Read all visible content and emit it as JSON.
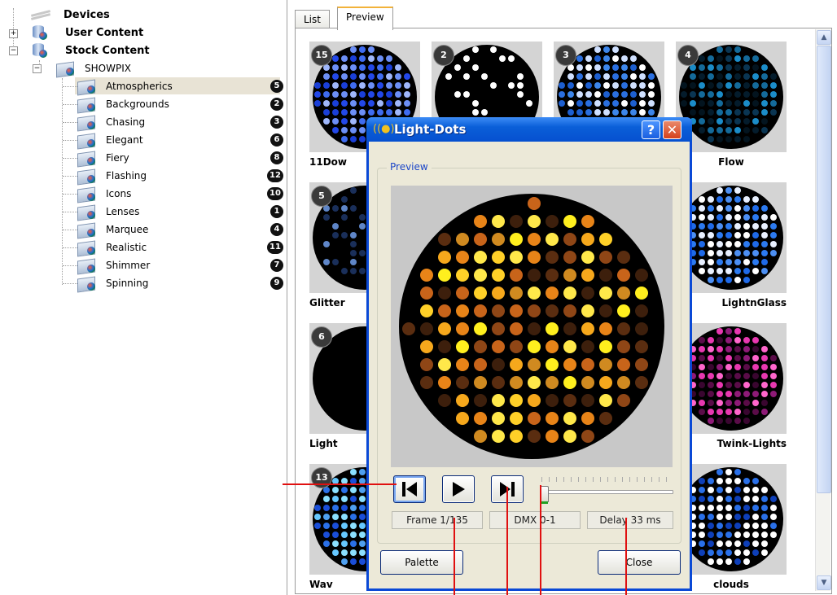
{
  "tree": {
    "devices": "Devices",
    "user_content": "User Content",
    "stock_content": "Stock Content",
    "showpix": "SHOWPIX",
    "items": [
      {
        "label": "Atmospherics",
        "count": "5"
      },
      {
        "label": "Backgrounds",
        "count": "2"
      },
      {
        "label": "Chasing",
        "count": "3"
      },
      {
        "label": "Elegant",
        "count": "6"
      },
      {
        "label": "Fiery",
        "count": "8"
      },
      {
        "label": "Flashing",
        "count": "12"
      },
      {
        "label": "Icons",
        "count": "10"
      },
      {
        "label": "Lenses",
        "count": "1"
      },
      {
        "label": "Marquee",
        "count": "4"
      },
      {
        "label": "Realistic",
        "count": "11"
      },
      {
        "label": "Shimmer",
        "count": "7"
      },
      {
        "label": "Spinning",
        "count": "9"
      }
    ],
    "selected": "Atmospherics"
  },
  "tabs": [
    {
      "label": "List"
    },
    {
      "label": "Preview"
    }
  ],
  "active_tab": "Preview",
  "thumbnails": [
    {
      "num": "15",
      "label": "11Dow"
    },
    {
      "num": "2",
      "label": ""
    },
    {
      "num": "3",
      "label": ""
    },
    {
      "num": "4",
      "label": "Flow"
    },
    {
      "num": "5",
      "label": "Glitter"
    },
    {
      "num": "",
      "label": "LightnGlass"
    },
    {
      "num": "6",
      "label": "Light"
    },
    {
      "num": "",
      "label": "Twink-Lights"
    },
    {
      "num": "13",
      "label": "Wav"
    },
    {
      "num": "",
      "label": "clouds"
    }
  ],
  "dialog": {
    "title": "Light-Dots",
    "help": "?",
    "close_x": "✕",
    "group_label": "Preview",
    "frame": "Frame 1/135",
    "dmx": "DMX 0-1",
    "delay": "Delay 33 ms",
    "palette_button": "Palette",
    "close_button": "Close",
    "slider_position": 0
  },
  "colors": {
    "dialog_border": "#0a49d6",
    "callout": "#e01010",
    "selection": "#e8e3d5"
  }
}
